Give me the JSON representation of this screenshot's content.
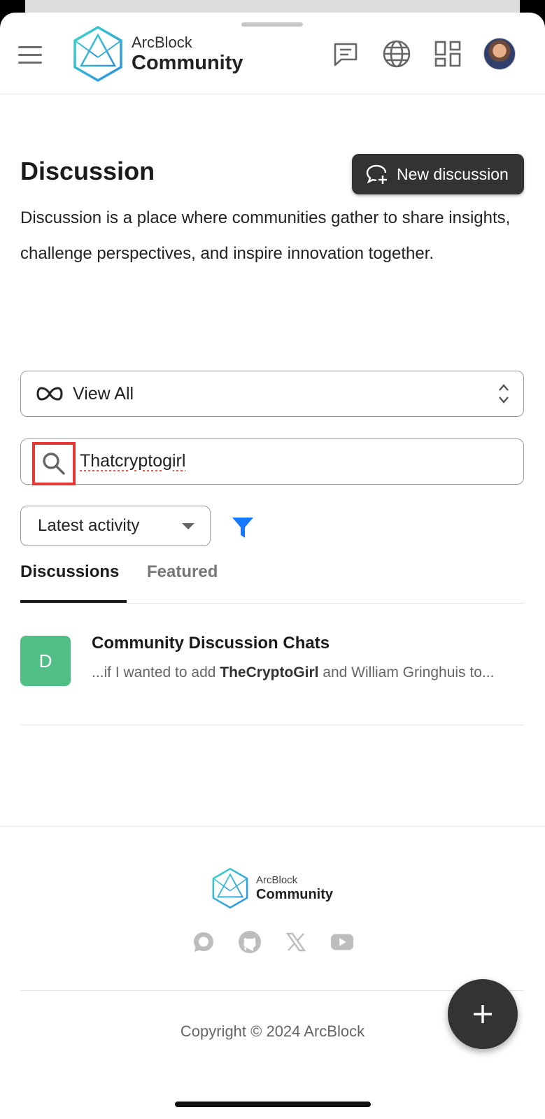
{
  "header": {
    "logo_sub": "ArcBlock",
    "logo_main": "Community",
    "icons": [
      "menu-icon",
      "chat-icon",
      "globe-icon",
      "apps-icon",
      "avatar"
    ]
  },
  "page": {
    "title": "Discussion",
    "new_button_label": "New discussion",
    "description": "Discussion is a place where communities gather to share insights, challenge perspectives, and inspire innovation together."
  },
  "filters": {
    "view_label": "View All",
    "search_value": "Thatcryptogirl",
    "sort_label": "Latest activity"
  },
  "tabs": [
    {
      "label": "Discussions",
      "active": true
    },
    {
      "label": "Featured",
      "active": false
    }
  ],
  "results": [
    {
      "avatar_letter": "D",
      "title": "Community Discussion Chats",
      "excerpt_before": "...if I wanted to add ",
      "excerpt_highlight": "TheCryptoGirl",
      "excerpt_after": " and William Gringhuis to..."
    }
  ],
  "footer": {
    "logo_sub": "ArcBlock",
    "logo_main": "Community",
    "socials": [
      "discourse-icon",
      "github-icon",
      "x-icon",
      "youtube-icon"
    ],
    "copyright": "Copyright © 2024 ArcBlock"
  },
  "colors": {
    "accent": "#1677ff",
    "brand_cyan": "#2bc6d8",
    "button_dark": "#333333",
    "avatar_green": "#4fbf85",
    "highlight_red": "#e53935"
  }
}
